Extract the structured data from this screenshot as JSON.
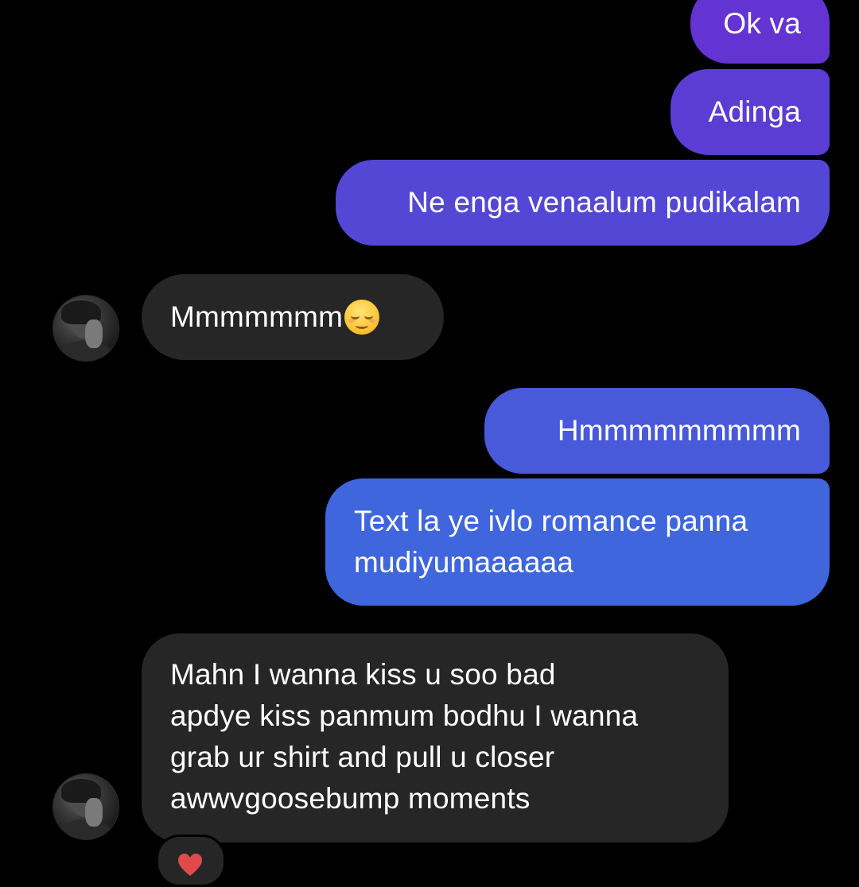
{
  "messages": {
    "sent_1": "Ok va",
    "sent_2": "Adinga",
    "sent_3": "Ne enga venaalum pudikalam",
    "received_1": "Mmmmmmm",
    "received_1_emoji": "relieved-face-emoji",
    "sent_4": "Hmmmmmmmmm",
    "sent_5": "Text la ye ivlo romance panna\nmudiyumaaaaaa",
    "received_2": "Mahn I wanna kiss u soo bad\napdye kiss panmum bodhu I wanna\ngrab ur shirt and pull u closer\nawwvgoosebump moments"
  },
  "reaction": {
    "icon": "red-heart-icon",
    "color": "#e04a4a"
  },
  "colors": {
    "background": "#000000",
    "received_bubble": "#262626",
    "sent_top": "#6334d2",
    "sent_bottom": "#3f66dc",
    "text": "#ffffff"
  }
}
